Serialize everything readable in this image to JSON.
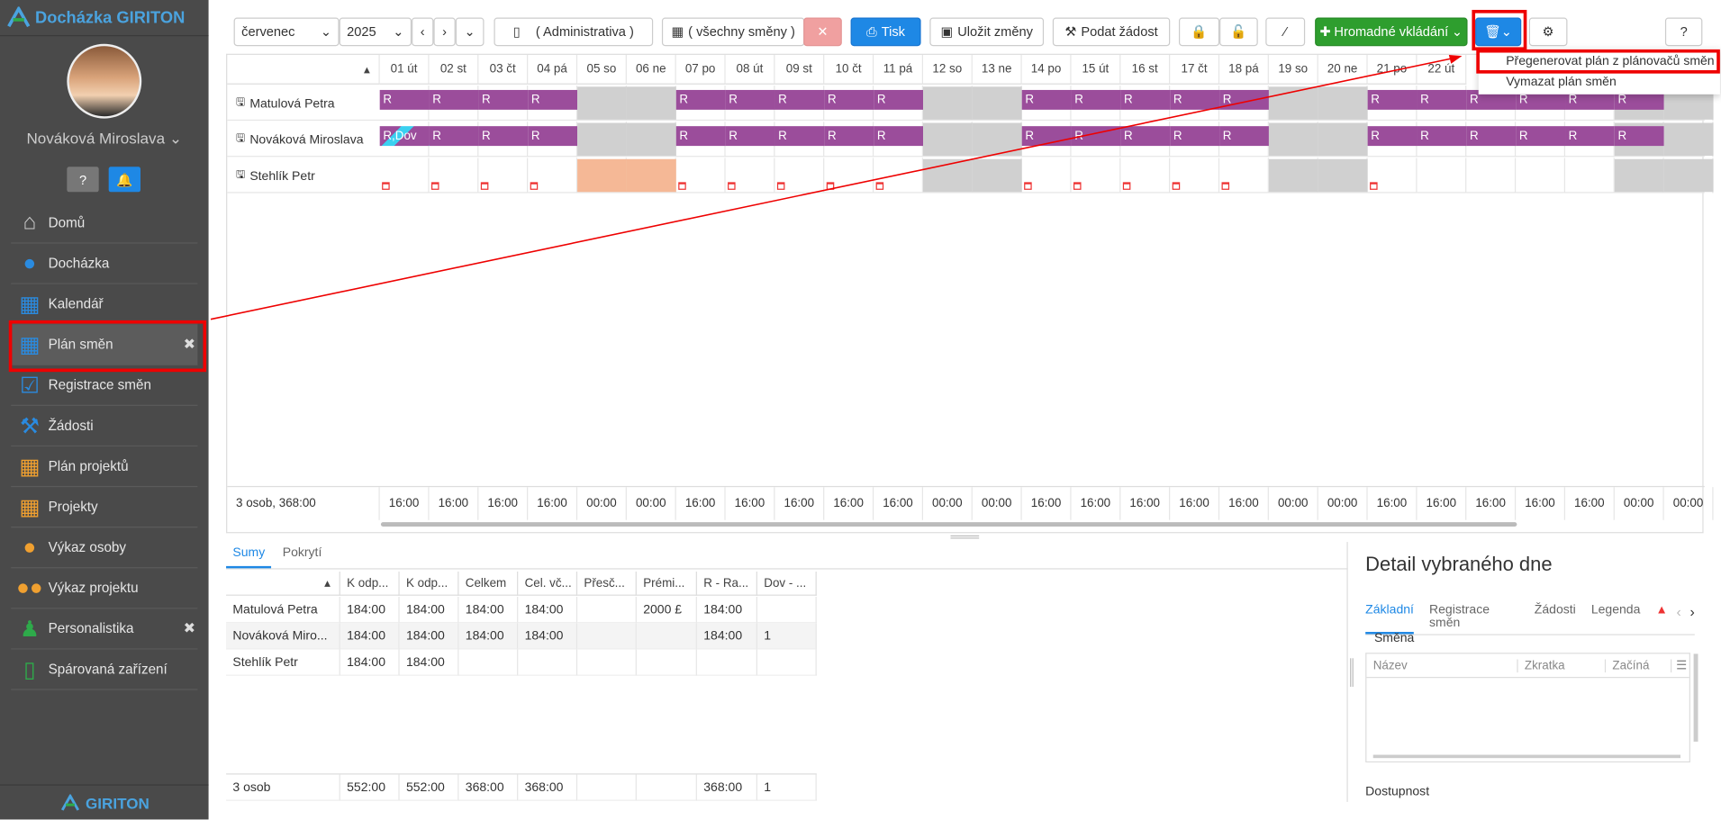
{
  "app": {
    "title": "Docházka GIRITON",
    "footer_brand": "GIRITON"
  },
  "user": {
    "name": "Nováková Miroslava"
  },
  "sidebar": {
    "help_icon": "question-icon",
    "bell_icon": "bell-icon",
    "items": [
      {
        "label": "Domů",
        "icon": "home-icon",
        "color": "#cfcfcf"
      },
      {
        "label": "Docházka",
        "icon": "person-icon",
        "color": "#2a8be0"
      },
      {
        "label": "Kalendář",
        "icon": "calendar-icon",
        "color": "#2a8be0"
      },
      {
        "label": "Plán směn",
        "icon": "calendar-grid-icon",
        "color": "#2a8be0",
        "active": true,
        "closable": true
      },
      {
        "label": "Registrace směn",
        "icon": "calendar-check-icon",
        "color": "#2a8be0"
      },
      {
        "label": "Žádosti",
        "icon": "gavel-icon",
        "color": "#2a8be0"
      },
      {
        "label": "Plán projektů",
        "icon": "calendar-icon",
        "color": "#f0a030"
      },
      {
        "label": "Projekty",
        "icon": "calendar-icon",
        "color": "#f0a030"
      },
      {
        "label": "Výkaz osoby",
        "icon": "person-icon",
        "color": "#f0a030"
      },
      {
        "label": "Výkaz projektu",
        "icon": "people-icon",
        "color": "#f0a030"
      },
      {
        "label": "Personalistika",
        "icon": "person-standing-icon",
        "color": "#2eaa4a",
        "closable": true
      },
      {
        "label": "Spárovaná zařízení",
        "icon": "phone-icon",
        "color": "#2eaa4a"
      }
    ]
  },
  "toolbar": {
    "month": "červenec",
    "year": "2025",
    "department": "( Administrativa )",
    "shifts": "( všechny směny )",
    "print": "Tisk",
    "save": "Uložit změny",
    "request": "Podat žádost",
    "bulk": "Hromadné vkládání"
  },
  "dropdown": {
    "items": [
      "Přegenerovat plán z plánovačů směn",
      "Vymazat plán směn"
    ]
  },
  "grid": {
    "days": [
      "01 út",
      "02 st",
      "03 čt",
      "04 pá",
      "05 so",
      "06 ne",
      "07 po",
      "08 út",
      "09 st",
      "10 čt",
      "11 pá",
      "12 so",
      "13 ne",
      "14 po",
      "15 út",
      "16 st",
      "17 čt",
      "18 pá",
      "19 so",
      "20 ne",
      "21 po",
      "22 út"
    ],
    "rows": [
      {
        "name": "Matulová Petra",
        "shifts": [
          "R",
          "R",
          "R",
          "R",
          "",
          "",
          "R",
          "R",
          "R",
          "R",
          "R",
          "",
          "",
          "R",
          "R",
          "R",
          "R",
          "R",
          "",
          "",
          "R",
          "R",
          "R",
          "R",
          "R",
          "R"
        ]
      },
      {
        "name": "Nováková Miroslava",
        "shifts": [
          "R,Dov",
          "R",
          "R",
          "R",
          "",
          "",
          "R",
          "R",
          "R",
          "R",
          "R",
          "",
          "",
          "R",
          "R",
          "R",
          "R",
          "R",
          "",
          "",
          "R",
          "R",
          "R",
          "R",
          "R",
          "R"
        ]
      },
      {
        "name": "Stehlík Petr",
        "shifts": []
      }
    ],
    "footer_label": "3 osob, 368:00",
    "footer_values": [
      "16:00",
      "16:00",
      "16:00",
      "16:00",
      "00:00",
      "00:00",
      "16:00",
      "16:00",
      "16:00",
      "16:00",
      "16:00",
      "00:00",
      "00:00",
      "16:00",
      "16:00",
      "16:00",
      "16:00",
      "16:00",
      "00:00",
      "00:00",
      "16:00",
      "16:00",
      "16:00",
      "16:00",
      "16:00",
      "00:00",
      "00:00"
    ]
  },
  "sums": {
    "tabs": [
      "Sumy",
      "Pokrytí"
    ],
    "columns": [
      "K odp...",
      "K odp...",
      "Celkem",
      "Cel. vč...",
      "Přesč...",
      "Prémi...",
      "R - Ra...",
      "Dov - ..."
    ],
    "rows": [
      {
        "name": "Matulová Petra",
        "values": [
          "184:00",
          "184:00",
          "184:00",
          "184:00",
          "",
          "2000 £",
          "184:00",
          ""
        ]
      },
      {
        "name": "Nováková Miro...",
        "values": [
          "184:00",
          "184:00",
          "184:00",
          "184:00",
          "",
          "",
          "184:00",
          "1"
        ]
      },
      {
        "name": "Stehlík Petr",
        "values": [
          "184:00",
          "184:00",
          "",
          "",
          "",
          "",
          "",
          ""
        ]
      }
    ],
    "footer": {
      "name": "3 osob",
      "values": [
        "552:00",
        "552:00",
        "368:00",
        "368:00",
        "",
        "",
        "368:00",
        "1"
      ]
    }
  },
  "detail": {
    "title": "Detail vybraného dne",
    "tabs": [
      "Základní",
      "Registrace směn",
      "Žádosti",
      "Legenda"
    ],
    "section": "Směna",
    "columns": [
      "Název",
      "Zkratka",
      "Začíná"
    ],
    "availability": "Dostupnost"
  }
}
